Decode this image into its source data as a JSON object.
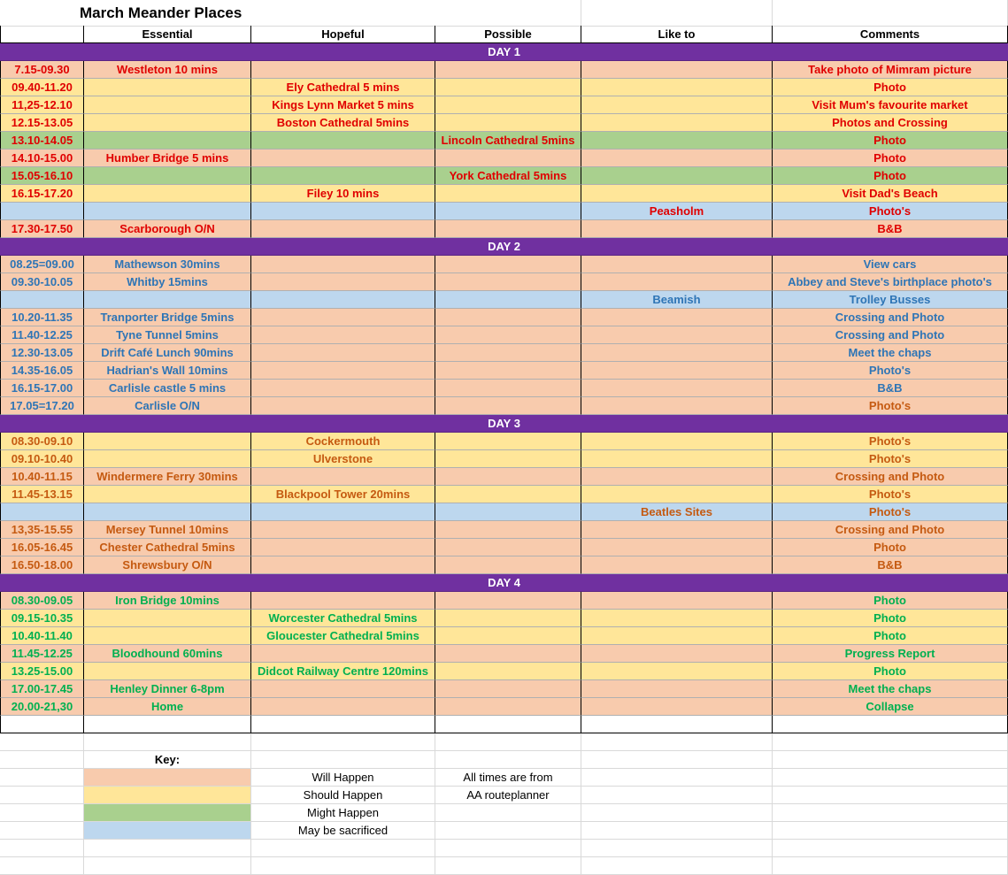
{
  "title": "March Meander Places",
  "headers": [
    "",
    "Essential",
    "Hopeful",
    "Possible",
    "Like to",
    "Comments"
  ],
  "colors": {
    "will": "#f8cbad",
    "should": "#ffe699",
    "might": "#a9d08e",
    "sacrificed": "#bdd7ee",
    "day_band": "#7030a0",
    "day1_text": "#e00000",
    "day2_text": "#2e75b6",
    "day3_text": "#c55a11",
    "day4_text": "#00b050"
  },
  "days": [
    {
      "label": "DAY 1",
      "text_color": "#e00000",
      "rows": [
        {
          "time": "7.15-09.30",
          "essential": "Westleton 10 mins",
          "hopeful": "",
          "possible": "",
          "like": "",
          "comment": "Take photo of Mimram picture",
          "status": "will"
        },
        {
          "time": "09.40-11.20",
          "essential": "",
          "hopeful": "Ely Cathedral 5 mins",
          "possible": "",
          "like": "",
          "comment": "Photo",
          "status": "should"
        },
        {
          "time": "11,25-12.10",
          "essential": "",
          "hopeful": "Kings Lynn Market 5 mins",
          "possible": "",
          "like": "",
          "comment": "Visit Mum's favourite market",
          "status": "should"
        },
        {
          "time": "12.15-13.05",
          "essential": "",
          "hopeful": "Boston Cathedral 5mins",
          "possible": "",
          "like": "",
          "comment": "Photos and Crossing",
          "status": "should"
        },
        {
          "time": "13.10-14.05",
          "essential": "",
          "hopeful": "",
          "possible": "Lincoln Cathedral 5mins",
          "like": "",
          "comment": "Photo",
          "status": "might"
        },
        {
          "time": "14.10-15.00",
          "essential": "Humber Bridge 5 mins",
          "hopeful": "",
          "possible": "",
          "like": "",
          "comment": "Photo",
          "status": "will"
        },
        {
          "time": "15.05-16.10",
          "essential": "",
          "hopeful": "",
          "possible": "York Cathedral 5mins",
          "like": "",
          "comment": "Photo",
          "status": "might"
        },
        {
          "time": "16.15-17.20",
          "essential": "",
          "hopeful": "Filey 10 mins",
          "possible": "",
          "like": "",
          "comment": "Visit Dad's Beach",
          "status": "should"
        },
        {
          "time": "",
          "essential": "",
          "hopeful": "",
          "possible": "",
          "like": "Peasholm",
          "comment": "Photo's",
          "status": "sacrificed"
        },
        {
          "time": "17.30-17.50",
          "essential": "Scarborough O/N",
          "hopeful": "",
          "possible": "",
          "like": "",
          "comment": "B&B",
          "status": "will"
        }
      ]
    },
    {
      "label": "DAY 2",
      "text_color": "#2e75b6",
      "rows": [
        {
          "time": "08.25=09.00",
          "essential": "Mathewson 30mins",
          "hopeful": "",
          "possible": "",
          "like": "",
          "comment": "View cars",
          "status": "will"
        },
        {
          "time": "09.30-10.05",
          "essential": "Whitby 15mins",
          "hopeful": "",
          "possible": "",
          "like": "",
          "comment": "Abbey and Steve's birthplace photo's",
          "status": "will"
        },
        {
          "time": "",
          "essential": "",
          "hopeful": "",
          "possible": "",
          "like": "Beamish",
          "comment": "Trolley Busses",
          "status": "sacrificed"
        },
        {
          "time": "10.20-11.35",
          "essential": "Tranporter Bridge 5mins",
          "hopeful": "",
          "possible": "",
          "like": "",
          "comment": "Crossing and Photo",
          "status": "will"
        },
        {
          "time": "11.40-12.25",
          "essential": "Tyne Tunnel 5mins",
          "hopeful": "",
          "possible": "",
          "like": "",
          "comment": "Crossing and Photo",
          "status": "will"
        },
        {
          "time": "12.30-13.05",
          "essential": "Drift Café Lunch 90mins",
          "hopeful": "",
          "possible": "",
          "like": "",
          "comment": "Meet the chaps",
          "status": "will"
        },
        {
          "time": "14.35-16.05",
          "essential": "Hadrian's Wall 10mins",
          "hopeful": "",
          "possible": "",
          "like": "",
          "comment": "Photo's",
          "status": "will"
        },
        {
          "time": "16.15-17.00",
          "essential": "Carlisle castle 5 mins",
          "hopeful": "",
          "possible": "",
          "like": "",
          "comment": "B&B",
          "status": "will"
        },
        {
          "time": "17.05=17.20",
          "essential": "Carlisle O/N",
          "hopeful": "",
          "possible": "",
          "like": "",
          "comment": "Photo's",
          "status": "will",
          "comment_color": "#c55a11"
        }
      ]
    },
    {
      "label": "DAY 3",
      "text_color": "#c55a11",
      "rows": [
        {
          "time": "08.30-09.10",
          "essential": "",
          "hopeful": "Cockermouth",
          "possible": "",
          "like": "",
          "comment": "Photo's",
          "status": "should"
        },
        {
          "time": "09.10-10.40",
          "essential": "",
          "hopeful": "Ulverstone",
          "possible": "",
          "like": "",
          "comment": "Photo's",
          "status": "should"
        },
        {
          "time": "10.40-11.15",
          "essential": "Windermere Ferry 30mins",
          "hopeful": "",
          "possible": "",
          "like": "",
          "comment": "Crossing and Photo",
          "status": "will"
        },
        {
          "time": "11.45-13.15",
          "essential": "",
          "hopeful": "Blackpool Tower 20mins",
          "possible": "",
          "like": "",
          "comment": "Photo's",
          "status": "should"
        },
        {
          "time": "",
          "essential": "",
          "hopeful": "",
          "possible": "",
          "like": "Beatles Sites",
          "comment": "Photo's",
          "status": "sacrificed"
        },
        {
          "time": "13,35-15.55",
          "essential": "Mersey Tunnel 10mins",
          "hopeful": "",
          "possible": "",
          "like": "",
          "comment": "Crossing and Photo",
          "status": "will"
        },
        {
          "time": "16.05-16.45",
          "essential": "Chester Cathedral 5mins",
          "hopeful": "",
          "possible": "",
          "like": "",
          "comment": "Photo",
          "status": "will"
        },
        {
          "time": "16.50-18.00",
          "essential": "Shrewsbury O/N",
          "hopeful": "",
          "possible": "",
          "like": "",
          "comment": "B&B",
          "status": "will"
        }
      ]
    },
    {
      "label": "DAY 4",
      "text_color": "#00b050",
      "rows": [
        {
          "time": "08.30-09.05",
          "essential": "Iron Bridge 10mins",
          "hopeful": "",
          "possible": "",
          "like": "",
          "comment": "Photo",
          "status": "will"
        },
        {
          "time": "09.15-10.35",
          "essential": "",
          "hopeful": "Worcester Cathedral 5mins",
          "possible": "",
          "like": "",
          "comment": "Photo",
          "status": "should"
        },
        {
          "time": "10.40-11.40",
          "essential": "",
          "hopeful": "Gloucester Cathedral 5mins",
          "possible": "",
          "like": "",
          "comment": "Photo",
          "status": "should"
        },
        {
          "time": "11.45-12.25",
          "essential": "Bloodhound 60mins",
          "hopeful": "",
          "possible": "",
          "like": "",
          "comment": "Progress Report",
          "status": "will"
        },
        {
          "time": "13.25-15.00",
          "essential": "",
          "hopeful": "Didcot Railway Centre 120mins",
          "possible": "",
          "like": "",
          "comment": "Photo",
          "status": "should"
        },
        {
          "time": "17.00-17.45",
          "essential": "Henley Dinner 6-8pm",
          "hopeful": "",
          "possible": "",
          "like": "",
          "comment": "Meet the chaps",
          "status": "will"
        },
        {
          "time": "20.00-21,30",
          "essential": "Home",
          "hopeful": "",
          "possible": "",
          "like": "",
          "comment": "Collapse",
          "status": "will"
        }
      ]
    }
  ],
  "key": {
    "title": "Key:",
    "items": [
      {
        "status": "will",
        "label": "Will Happen"
      },
      {
        "status": "should",
        "label": "Should Happen"
      },
      {
        "status": "might",
        "label": "Might Happen"
      },
      {
        "status": "sacrificed",
        "label": "May be sacrificed"
      }
    ],
    "note_lines": [
      "All times are from",
      "AA routeplanner"
    ]
  }
}
